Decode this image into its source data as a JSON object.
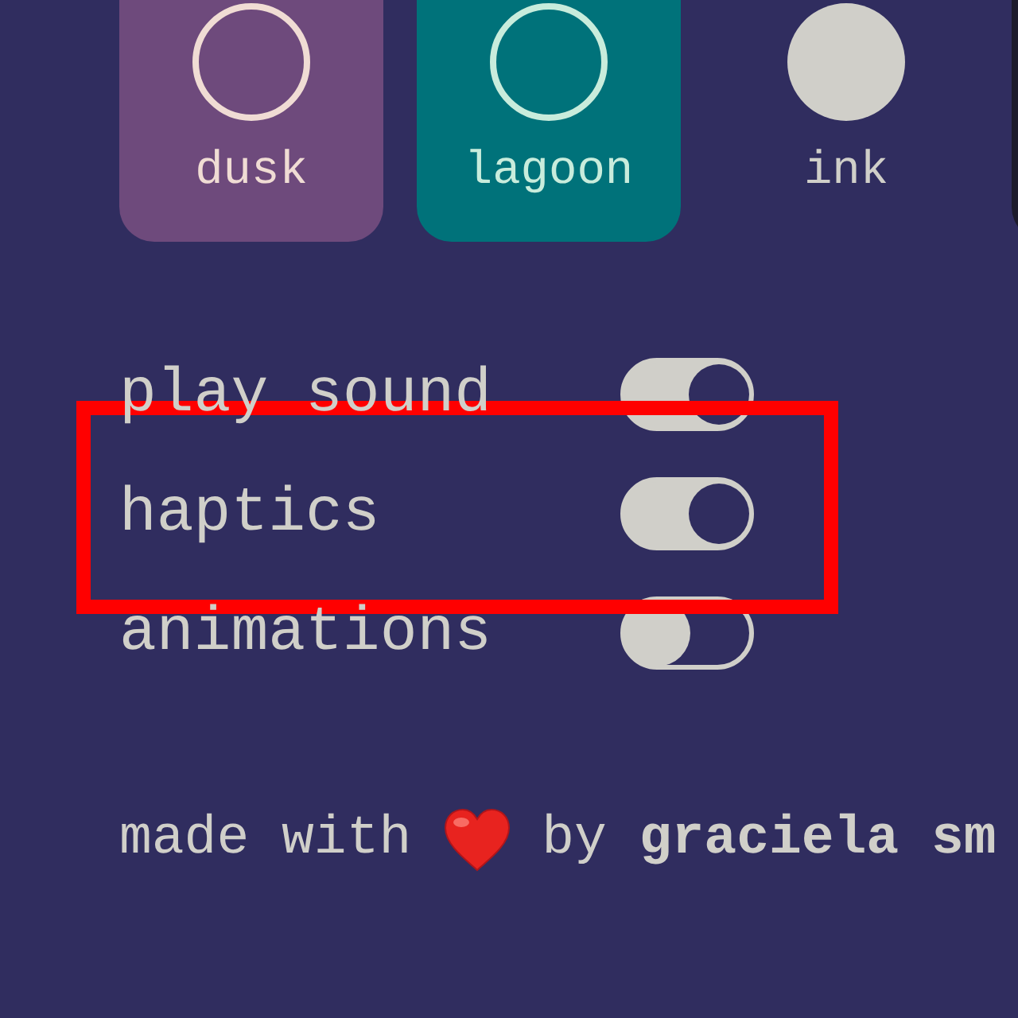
{
  "themes": [
    {
      "name": "dusk",
      "selected": false,
      "tile": {
        "color": "#6e4a7c"
      },
      "icon": {
        "color": "#f0dcd4"
      }
    },
    {
      "name": "lagoon",
      "selected": false,
      "tile": {
        "color": "#00727a"
      },
      "icon": {
        "color": "#c8ecdc"
      }
    },
    {
      "name": "ink",
      "selected": true,
      "icon": {
        "color": "#d0cfc9"
      }
    },
    {
      "selected": false,
      "tile": {
        "color": "#1d1b2c"
      }
    }
  ],
  "settings": [
    {
      "label": "play sound",
      "on": true,
      "highlighted": false
    },
    {
      "label": "haptics",
      "on": true,
      "highlighted": true
    },
    {
      "label": "animations",
      "on": false,
      "highlighted": false
    }
  ],
  "footer": {
    "text_before_icon": "made with",
    "text_after_icon": "by **graciela sm**"
  }
}
